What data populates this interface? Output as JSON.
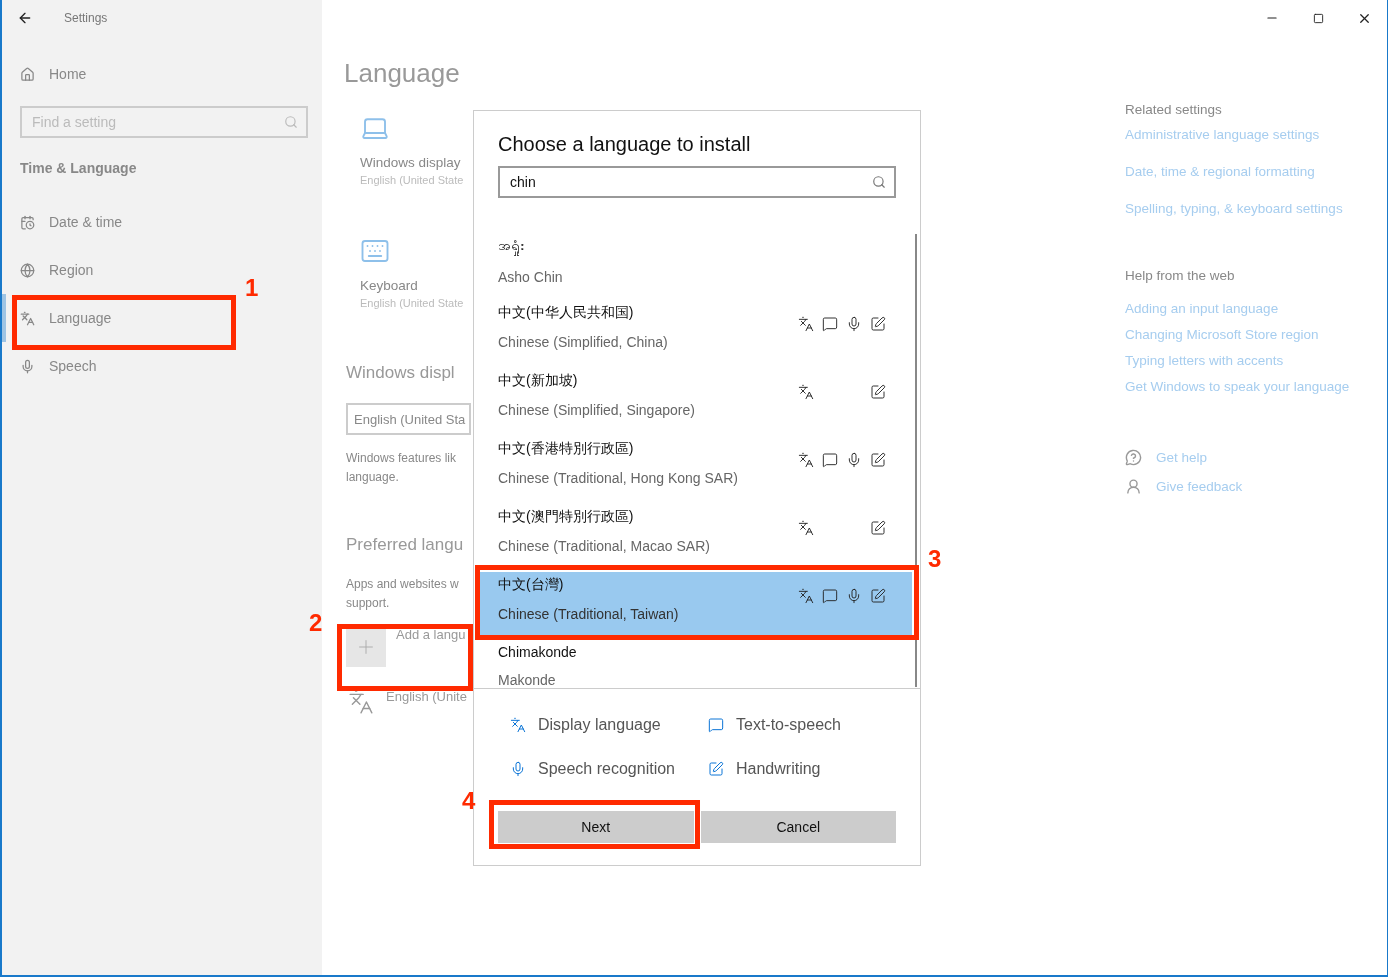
{
  "window": {
    "title": "Settings"
  },
  "sidebar": {
    "home": "Home",
    "search": {
      "placeholder": "Find a setting"
    },
    "section": "Time & Language",
    "items": [
      {
        "kind": "calendar",
        "label": "Date & time",
        "selected": false
      },
      {
        "kind": "globe",
        "label": "Region",
        "selected": false
      },
      {
        "kind": "language",
        "label": "Language",
        "selected": true
      },
      {
        "kind": "mic",
        "label": "Speech",
        "selected": false
      }
    ]
  },
  "main": {
    "title": "Language",
    "tiles": [
      {
        "kind": "laptop",
        "label": "Windows display",
        "sub": "English (United State"
      },
      {
        "kind": "keyboard",
        "label": "Keyboard",
        "sub": "English (United State"
      }
    ],
    "display_heading": "Windows displ",
    "display_dropdown": "English (United Sta",
    "display_note": [
      "Windows features lik",
      "language."
    ],
    "preferred_heading": "Preferred langu",
    "preferred_note": [
      "Apps and websites w",
      "support."
    ],
    "add_label": "Add a langu",
    "english_row": "English (Unite"
  },
  "related": {
    "heading": "Related settings",
    "links": [
      "Administrative language settings",
      "Date, time & regional formatting",
      "Spelling, typing, & keyboard settings"
    ]
  },
  "help": {
    "heading": "Help from the web",
    "links": [
      "Adding an input language",
      "Changing Microsoft Store region",
      "Typing letters with accents",
      "Get Windows to speak your language"
    ]
  },
  "support": [
    {
      "kind": "help",
      "label": "Get help"
    },
    {
      "kind": "feedback",
      "label": "Give feedback"
    }
  ],
  "dialog": {
    "title": "Choose a language to install",
    "search": {
      "value": "chin"
    },
    "languages": [
      {
        "native": "အရှုံး",
        "english": "Asho Chin",
        "display": false,
        "tts": false,
        "speech": false,
        "handwriting": false,
        "selected": false
      },
      {
        "native": "中文(中华人民共和国)",
        "english": "Chinese (Simplified, China)",
        "display": true,
        "tts": true,
        "speech": true,
        "handwriting": true,
        "selected": false
      },
      {
        "native": "中文(新加坡)",
        "english": "Chinese (Simplified, Singapore)",
        "display": true,
        "tts": false,
        "speech": false,
        "handwriting": true,
        "selected": false
      },
      {
        "native": "中文(香港特別行政區)",
        "english": "Chinese (Traditional, Hong Kong SAR)",
        "display": true,
        "tts": true,
        "speech": true,
        "handwriting": true,
        "selected": false
      },
      {
        "native": "中文(澳門特別行政區)",
        "english": "Chinese (Traditional, Macao SAR)",
        "display": true,
        "tts": false,
        "speech": false,
        "handwriting": true,
        "selected": false
      },
      {
        "native": "中文(台灣)",
        "english": "Chinese (Traditional, Taiwan)",
        "display": true,
        "tts": true,
        "speech": true,
        "handwriting": true,
        "selected": true
      },
      {
        "native": "Chimakonde",
        "english": "Makonde",
        "display": false,
        "tts": false,
        "speech": false,
        "handwriting": false,
        "selected": false
      }
    ],
    "legend": [
      {
        "kind": "display",
        "label": "Display language"
      },
      {
        "kind": "tts",
        "label": "Text-to-speech"
      },
      {
        "kind": "speech",
        "label": "Speech recognition"
      },
      {
        "kind": "handwriting",
        "label": "Handwriting"
      }
    ],
    "buttons": [
      "Next",
      "Cancel"
    ]
  },
  "annotations": [
    {
      "label": "1"
    },
    {
      "label": "2"
    },
    {
      "label": "3"
    },
    {
      "label": "4"
    }
  ]
}
